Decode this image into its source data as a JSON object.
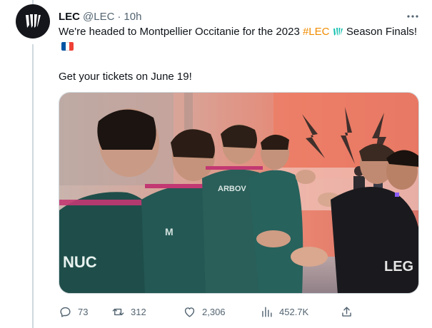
{
  "author": {
    "name": "LEC",
    "handle": "@LEC",
    "separator": "·",
    "time": "10h",
    "avatar_icon": "lec-logo-icon"
  },
  "tweet": {
    "line1_prefix": "We're headed to Montpellier Occitanie for the 2023",
    "hashtag": "#LEC",
    "line1_suffix": "Season Finals!",
    "line2": "Get your tickets on June 19!"
  },
  "media": {
    "description_icon": "photo-players-high-five"
  },
  "actions": {
    "replies": "73",
    "retweets": "312",
    "likes": "2,306",
    "views": "452.7K"
  },
  "colors": {
    "hashtag": "#f08c00",
    "muted": "#536471",
    "text": "#0f1419",
    "lec_teal": "#16c1b0"
  }
}
